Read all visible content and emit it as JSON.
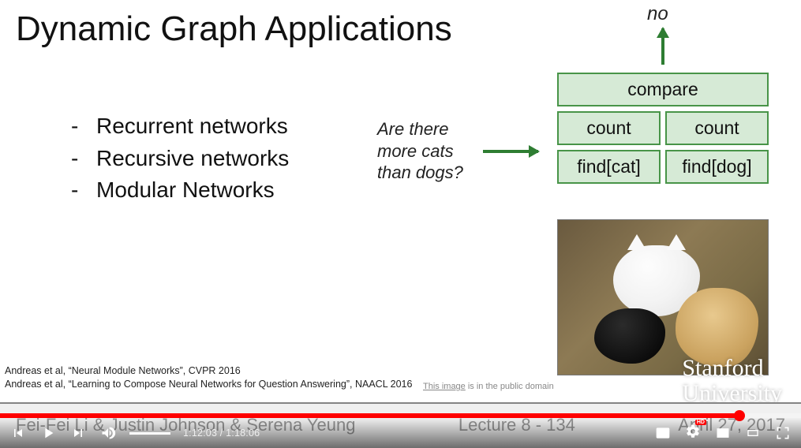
{
  "slide": {
    "title": "Dynamic Graph Applications",
    "bullets": [
      "Recurrent networks",
      "Recursive networks",
      "Modular Networks"
    ],
    "question_lines": [
      "Are there",
      "more cats",
      "than dogs?"
    ],
    "answer": "no",
    "modules": {
      "top": "compare",
      "mid": [
        "count",
        "count"
      ],
      "bot": [
        "find[cat]",
        "find[dog]"
      ]
    },
    "citations": [
      "Andreas et al, “Neural Module Networks”, CVPR 2016",
      "Andreas et al, “Learning to Compose Neural Networks for Question Answering”, NAACL 2016"
    ],
    "image_note": {
      "link_text": "This image",
      "tail": " is in the public domain"
    },
    "university": [
      "Stanford",
      "University"
    ],
    "footer": {
      "authors": "Fei-Fei Li & Justin Johnson & Serena Yeung",
      "lecture": "Lecture 8 - 134",
      "date": "April 27, 2017"
    }
  },
  "player": {
    "time_current": "1:12:03",
    "time_total": "1:18:06",
    "progress_fraction": 0.923,
    "hd_label": "HD"
  }
}
